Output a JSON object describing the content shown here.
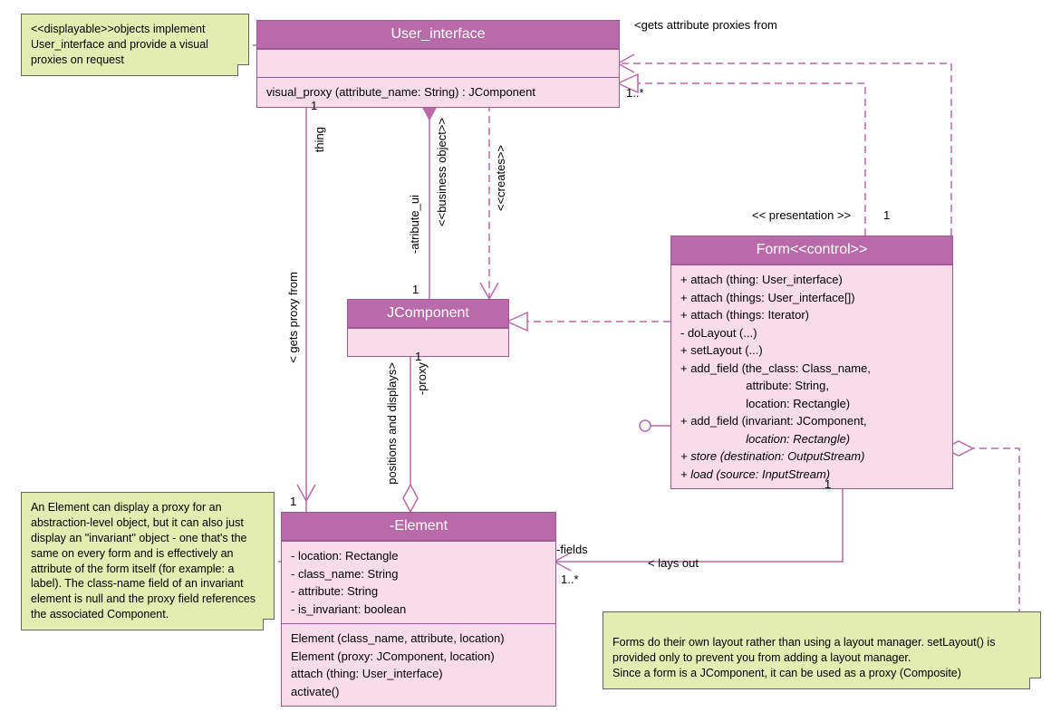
{
  "chart_data": {
    "type": "uml_class_diagram",
    "classes": [
      {
        "id": "user_interface",
        "name": "User_interface",
        "stereotype": null,
        "attributes": [],
        "operations": [
          "visual_proxy (attribute_name: String) : JComponent"
        ]
      },
      {
        "id": "jcomponent",
        "name": "JComponent",
        "stereotype": null,
        "attributes": [],
        "operations": []
      },
      {
        "id": "form",
        "name": "Form<<control>>",
        "stereotype": "control",
        "attributes": [],
        "operations": [
          "+ attach (thing: User_interface)",
          "+ attach (things: User_interface[])",
          "+ attach (things: Iterator)",
          "- doLayout (...)",
          "+ setLayout (...)",
          "+ add_field (the_class: Class_name,",
          "                    attribute: String,",
          "                    location: Rectangle)",
          "+ add_field (invariant: JComponent,",
          "                    location: Rectangle)",
          "+ store (destination: OutputStream)",
          "+ load (source: InputStream)"
        ]
      },
      {
        "id": "element",
        "name": "-Element",
        "stereotype": null,
        "attributes": [
          "- location: Rectangle",
          "- class_name: String",
          "- attribute: String",
          "- is_invariant: boolean"
        ],
        "operations": [
          "Element (class_name, attribute, location)",
          "Element (proxy: JComponent, location)",
          "attach (thing: User_interface)",
          "activate()"
        ]
      }
    ],
    "notes": [
      {
        "id": "note_displayable",
        "text": "<<displayable>>objects implement User_interface and provide a visual proxies on request",
        "attached_to": "user_interface"
      },
      {
        "id": "note_element",
        "text": "An Element can display a proxy for an abstraction-level object, but it can also just display an \"invariant\" object - one that's the same on every form and is effectively an attribute of the form itself (for example: a label). The class-name field of an invariant element is null and the proxy field references the associated Component.",
        "attached_to": "element"
      },
      {
        "id": "note_form",
        "text": "Forms do their own layout rather than using a layout manager. setLayout() is provided only to prevent you from adding a layout manager.\nSince a form is a JComponent, it can be used as a proxy (Composite)",
        "attached_to": "form"
      }
    ],
    "relationships": [
      {
        "from": "form",
        "to": "user_interface",
        "kind": "dependency",
        "label": "<gets attribute proxies from",
        "from_mult": null,
        "to_mult": "1..*"
      },
      {
        "from": "form",
        "to": "user_interface",
        "kind": "realization",
        "label": "<< presentation >>",
        "from_mult": "1",
        "to_mult": null
      },
      {
        "from": "form",
        "to": "jcomponent",
        "kind": "generalization_dashed",
        "label": null
      },
      {
        "from": "form",
        "to": "element",
        "kind": "aggregation",
        "label": "< lays out",
        "role_to": "-fields",
        "from_mult": "1",
        "to_mult": "1..*"
      },
      {
        "from": "form",
        "to": "form",
        "kind": "self_aggregation",
        "label": null
      },
      {
        "from": "element",
        "to": "jcomponent",
        "kind": "aggregation",
        "label": "positions and displays>",
        "role_to": "-proxy",
        "from_mult": null,
        "to_mult": "1"
      },
      {
        "from": "user_interface",
        "to": "jcomponent",
        "kind": "composition",
        "label": "<<business object>>",
        "role": "-atribute_ui",
        "from_mult": null,
        "to_mult": "1"
      },
      {
        "from": "user_interface",
        "to": "jcomponent",
        "kind": "dependency",
        "label": "<<creates>>"
      },
      {
        "from": "element",
        "to": "user_interface",
        "kind": "association",
        "label": "< gets proxy from",
        "role_to": "thing",
        "from_mult": "1",
        "to_mult": "1"
      }
    ]
  },
  "classes": {
    "user_interface": {
      "name": "User_interface",
      "op1": "visual_proxy (attribute_name: String) : JComponent"
    },
    "jcomponent": {
      "name": "JComponent"
    },
    "form": {
      "name": "Form<<control>>",
      "ops": {
        "l1": "+ attach (thing: User_interface)",
        "l2": "+ attach (things: User_interface[])",
        "l3": "+ attach (things: Iterator)",
        "l4": "- doLayout (...)",
        "l5": "+ setLayout (...)",
        "l6": "+ add_field (the_class: Class_name,",
        "l7": "                    attribute: String,",
        "l8": "                    location: Rectangle)",
        "l9": "+ add_field (invariant: JComponent,",
        "l10": "                    location: Rectangle)",
        "l11": "+ store (destination: OutputStream)",
        "l12": "+ load (source: InputStream)"
      }
    },
    "element": {
      "name": "-Element",
      "attrs": {
        "a1": "- location: Rectangle",
        "a2": "- class_name: String",
        "a3": "- attribute: String",
        "a4": "- is_invariant: boolean"
      },
      "ops": {
        "o1": "Element (class_name, attribute, location)",
        "o2": "Element (proxy: JComponent, location)",
        "o3": "attach (thing: User_interface)",
        "o4": "activate()"
      }
    }
  },
  "notes": {
    "displayable": "<<displayable>>objects implement User_interface and provide a visual proxies on request",
    "element": "An Element can display a proxy for an abstraction-level object, but it can also just display an \"invariant\" object - one that's the same on every form and is effectively an attribute of the form itself (for example: a label). The class-name field of an invariant element is null and the proxy field references the associated Component.",
    "form": "Forms do their own layout rather than using a layout manager. setLayout() is provided only to prevent you from adding a layout manager.\nSince a form is a JComponent, it can be used as a proxy (Composite)"
  },
  "labels": {
    "gets_attr_proxies": "<gets attribute proxies from",
    "one_star": "1..*",
    "presentation": "<< presentation >>",
    "one": "1",
    "thing": "thing",
    "business_object": "<<business object>>",
    "creates": "<<creates>>",
    "atribute_ui": "-atribute_ui",
    "gets_proxy_from": "< gets proxy from",
    "positions_displays": "positions and displays>",
    "proxy": "-proxy",
    "fields": "-fields",
    "lays_out": "< lays out",
    "one_b": "1",
    "one_c": "1",
    "one_d": "1",
    "one_e": "1",
    "one_star_b": "1..*",
    "one_f": "1"
  }
}
